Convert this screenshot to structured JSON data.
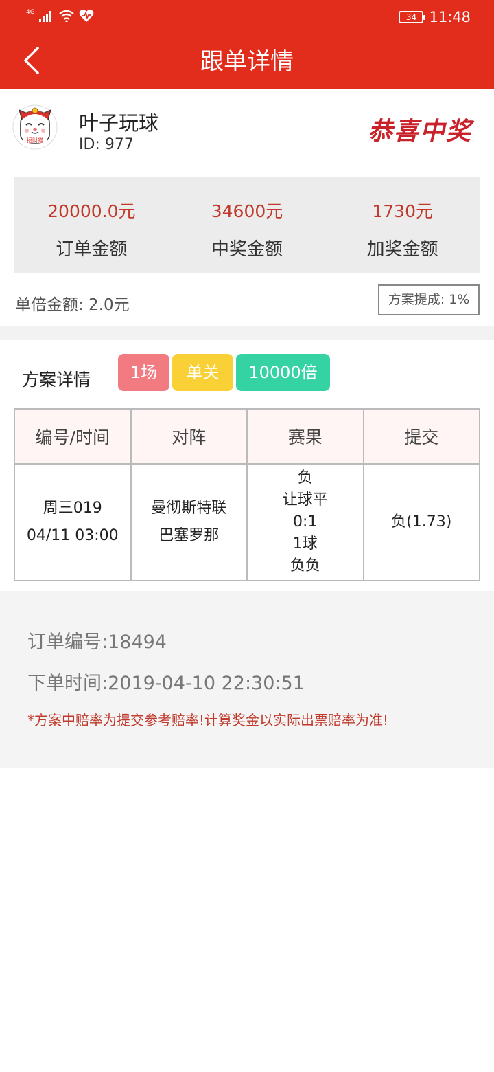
{
  "status_bar": {
    "network": "4G",
    "battery": "34",
    "time": "11:48"
  },
  "navbar": {
    "title": "跟单详情"
  },
  "user": {
    "name": "叶子玩球",
    "id": "ID: 977",
    "avatar_caption": "招财猫",
    "win_stamp": "恭喜中奖"
  },
  "amounts": [
    {
      "value": "20000.0元",
      "label": "订单金额"
    },
    {
      "value": "34600元",
      "label": "中奖金额"
    },
    {
      "value": "1730元",
      "label": "加奖金额"
    }
  ],
  "single_amount": "单倍金额: 2.0元",
  "commission": "方案提成: 1%",
  "plan": {
    "label": "方案详情",
    "tags": {
      "matches": "1场",
      "type": "单关",
      "multiple": "10000倍"
    }
  },
  "table": {
    "headers": [
      "编号/时间",
      "对阵",
      "赛果",
      "提交"
    ],
    "row": {
      "number": "周三019",
      "time": "04/11 03:00",
      "home": "曼彻斯特联",
      "away": "巴塞罗那",
      "results": [
        "负",
        "让球平",
        "0:1",
        "1球",
        "负负"
      ],
      "submit": "负(1.73)"
    }
  },
  "order": {
    "number": "订单编号:18494",
    "time": "下单时间:2019-04-10 22:30:51",
    "note": "*方案中赔率为提交参考赔率!计算奖金以实际出票赔率为准!"
  },
  "colors": {
    "brand_red": "#e22d1c",
    "value_red": "#c0392b",
    "tag_pink": "#f17b80",
    "tag_yellow": "#f9d137",
    "tag_green": "#35d2a3"
  }
}
